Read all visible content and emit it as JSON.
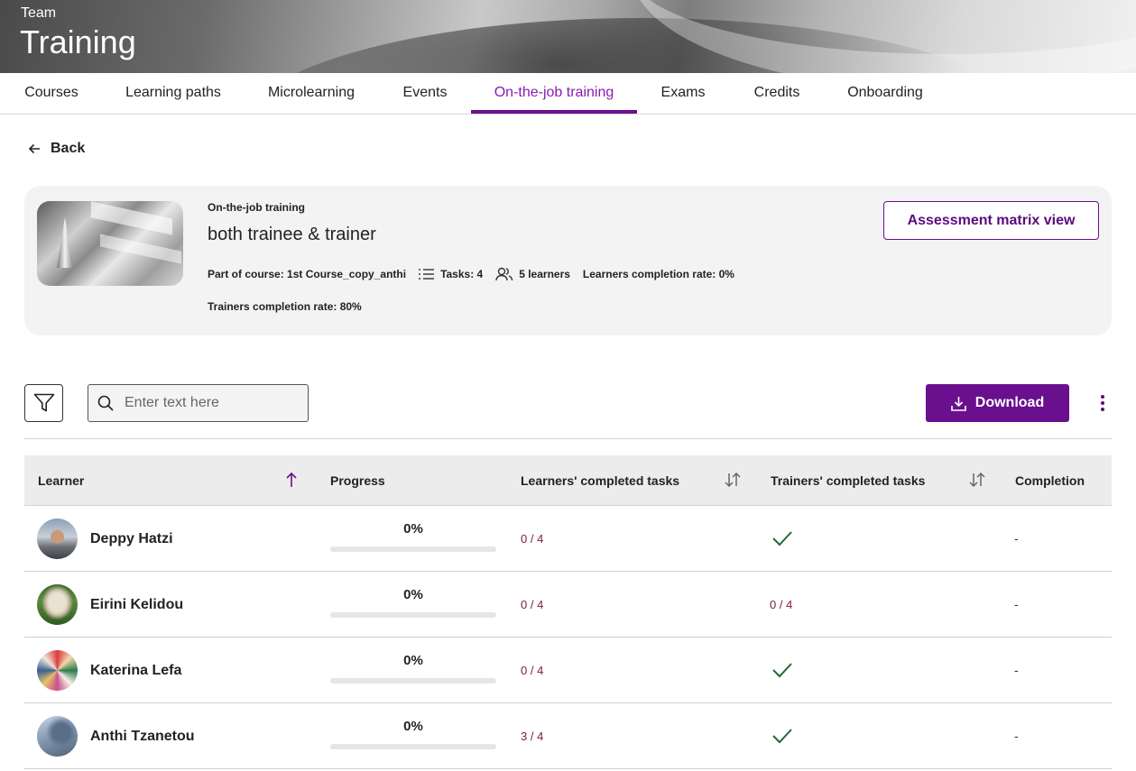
{
  "header": {
    "subtitle": "Team",
    "title": "Training"
  },
  "tabs": [
    {
      "label": "Courses"
    },
    {
      "label": "Learning paths"
    },
    {
      "label": "Microlearning"
    },
    {
      "label": "Events"
    },
    {
      "label": "On-the-job training",
      "active": true
    },
    {
      "label": "Exams"
    },
    {
      "label": "Credits"
    },
    {
      "label": "Onboarding"
    }
  ],
  "back": {
    "label": "Back"
  },
  "training": {
    "kicker": "On-the-job training",
    "name": "both trainee & trainer",
    "course": "Part of course: 1st Course_copy_anthi",
    "tasks": "Tasks: 4",
    "learners": "5 learners",
    "learners_rate": "Learners completion rate: 0%",
    "trainers_rate": "Trainers completion rate: 80%",
    "matrix_button": "Assessment matrix view"
  },
  "toolbar": {
    "search_placeholder": "Enter text here",
    "download_label": "Download"
  },
  "table": {
    "headers": {
      "learner": "Learner",
      "progress": "Progress",
      "learners_tasks": "Learners' completed tasks",
      "trainers_tasks": "Trainers' completed tasks",
      "completion": "Completion"
    },
    "rows": [
      {
        "name": "Deppy Hatzi",
        "progress": "0%",
        "progress_value": 0,
        "learner_tasks": "0 / 4",
        "trainer_tasks": "",
        "trainer_done": true,
        "completion": "-"
      },
      {
        "name": "Eirini Kelidou",
        "progress": "0%",
        "progress_value": 0,
        "learner_tasks": "0 / 4",
        "trainer_tasks": "0 / 4",
        "trainer_done": false,
        "completion": "-"
      },
      {
        "name": "Katerina Lefa",
        "progress": "0%",
        "progress_value": 0,
        "learner_tasks": "0 / 4",
        "trainer_tasks": "",
        "trainer_done": true,
        "completion": "-"
      },
      {
        "name": "Anthi Tzanetou",
        "progress": "0%",
        "progress_value": 0,
        "learner_tasks": "3 / 4",
        "trainer_tasks": "",
        "trainer_done": true,
        "completion": "-"
      }
    ]
  },
  "colors": {
    "accent": "#6a0f8e",
    "active_tab": "#8a1bb0",
    "count_text": "#7a1a4a",
    "check": "#1e6b35"
  }
}
